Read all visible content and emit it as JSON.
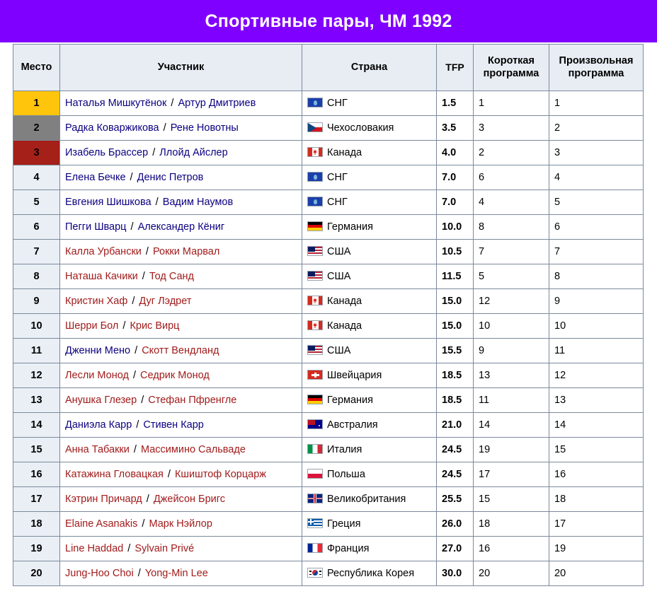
{
  "header": {
    "title": "Спортивные пары, ЧМ 1992",
    "banner_color": "#8000FF"
  },
  "table": {
    "columns": [
      {
        "key": "place",
        "label": "Место"
      },
      {
        "key": "part",
        "label": "Участник"
      },
      {
        "key": "country",
        "label": "Страна"
      },
      {
        "key": "tfp",
        "label": "TFP"
      },
      {
        "key": "sp",
        "label": "Короткая программа"
      },
      {
        "key": "fp",
        "label": "Произвольная программа"
      }
    ],
    "column_labels_wrapped": {
      "sp_line1": "Короткая",
      "sp_line2": "программа",
      "fp_line1": "Произвольная",
      "fp_line2": "программа"
    },
    "medal_colors": {
      "gold": "#FFC40C",
      "silver": "#808080",
      "bronze": "#A52019"
    },
    "link_colors": {
      "existing": "#0b0080",
      "missing": "#a11b1b"
    },
    "rows": [
      {
        "place": "1",
        "medal": "gold",
        "skater1": "Наталья Мишкутёнок",
        "skater1_color": "blue",
        "skater2": "Артур Дмитриев",
        "skater2_color": "blue",
        "flag": "fl-cis",
        "flag_name": "flag-cis",
        "country": "СНГ",
        "tfp": "1.5",
        "sp": "1",
        "fp": "1"
      },
      {
        "place": "2",
        "medal": "silver",
        "skater1": "Радка Коваржикова",
        "skater1_color": "blue",
        "skater2": "Рене Новотны",
        "skater2_color": "blue",
        "flag": "fl-cze",
        "flag_name": "flag-czechoslovakia",
        "country": "Чехословакия",
        "tfp": "3.5",
        "sp": "3",
        "fp": "2"
      },
      {
        "place": "3",
        "medal": "bronze",
        "skater1": "Изабель Брассер",
        "skater1_color": "blue",
        "skater2": "Ллойд Айслер",
        "skater2_color": "blue",
        "flag": "fl-can",
        "flag_name": "flag-canada",
        "country": "Канада",
        "tfp": "4.0",
        "sp": "2",
        "fp": "3"
      },
      {
        "place": "4",
        "medal": "",
        "skater1": "Елена Бечке",
        "skater1_color": "blue",
        "skater2": "Денис Петров",
        "skater2_color": "blue",
        "flag": "fl-cis",
        "flag_name": "flag-cis",
        "country": "СНГ",
        "tfp": "7.0",
        "sp": "6",
        "fp": "4"
      },
      {
        "place": "5",
        "medal": "",
        "skater1": "Евгения Шишкова",
        "skater1_color": "blue",
        "skater2": "Вадим Наумов",
        "skater2_color": "blue",
        "flag": "fl-cis",
        "flag_name": "flag-cis",
        "country": "СНГ",
        "tfp": "7.0",
        "sp": "4",
        "fp": "5"
      },
      {
        "place": "6",
        "medal": "",
        "skater1": "Пегги Шварц",
        "skater1_color": "blue",
        "skater2": "Александер Кёниг",
        "skater2_color": "blue",
        "flag": "fl-ger",
        "flag_name": "flag-germany",
        "country": "Германия",
        "tfp": "10.0",
        "sp": "8",
        "fp": "6"
      },
      {
        "place": "7",
        "medal": "",
        "skater1": "Калла Урбански",
        "skater1_color": "red",
        "skater2": "Рокки Марвал",
        "skater2_color": "red",
        "flag": "fl-usa",
        "flag_name": "flag-usa",
        "country": "США",
        "tfp": "10.5",
        "sp": "7",
        "fp": "7"
      },
      {
        "place": "8",
        "medal": "",
        "skater1": "Наташа Качики",
        "skater1_color": "red",
        "skater2": "Тод Санд",
        "skater2_color": "red",
        "flag": "fl-usa",
        "flag_name": "flag-usa",
        "country": "США",
        "tfp": "11.5",
        "sp": "5",
        "fp": "8"
      },
      {
        "place": "9",
        "medal": "",
        "skater1": "Кристин Хаф",
        "skater1_color": "red",
        "skater2": "Дуг Лэдрет",
        "skater2_color": "red",
        "flag": "fl-can",
        "flag_name": "flag-canada",
        "country": "Канада",
        "tfp": "15.0",
        "sp": "12",
        "fp": "9"
      },
      {
        "place": "10",
        "medal": "",
        "skater1": "Шерри Бол",
        "skater1_color": "red",
        "skater2": "Крис Вирц",
        "skater2_color": "red",
        "flag": "fl-can",
        "flag_name": "flag-canada",
        "country": "Канада",
        "tfp": "15.0",
        "sp": "10",
        "fp": "10"
      },
      {
        "place": "11",
        "medal": "",
        "skater1": "Дженни Мено",
        "skater1_color": "blue",
        "skater2": "Скотт Вендланд",
        "skater2_color": "red",
        "flag": "fl-usa",
        "flag_name": "flag-usa",
        "country": "США",
        "tfp": "15.5",
        "sp": "9",
        "fp": "11"
      },
      {
        "place": "12",
        "medal": "",
        "skater1": "Лесли Монод",
        "skater1_color": "red",
        "skater2": "Седрик Монод",
        "skater2_color": "red",
        "flag": "fl-sui",
        "flag_name": "flag-switzerland",
        "country": "Швейцария",
        "tfp": "18.5",
        "sp": "13",
        "fp": "12"
      },
      {
        "place": "13",
        "medal": "",
        "skater1": "Анушка Глезер",
        "skater1_color": "red",
        "skater2": "Стефан Пфренгле",
        "skater2_color": "red",
        "flag": "fl-ger",
        "flag_name": "flag-germany",
        "country": "Германия",
        "tfp": "18.5",
        "sp": "11",
        "fp": "13"
      },
      {
        "place": "14",
        "medal": "",
        "skater1": "Даниэла Карр",
        "skater1_color": "blue",
        "skater2": "Стивен Карр",
        "skater2_color": "blue",
        "flag": "fl-aus",
        "flag_name": "flag-australia",
        "country": "Австралия",
        "tfp": "21.0",
        "sp": "14",
        "fp": "14"
      },
      {
        "place": "15",
        "medal": "",
        "skater1": "Анна Табакки",
        "skater1_color": "red",
        "skater2": "Массимино Сальваде",
        "skater2_color": "red",
        "flag": "fl-ita",
        "flag_name": "flag-italy",
        "country": "Италия",
        "tfp": "24.5",
        "sp": "19",
        "fp": "15"
      },
      {
        "place": "16",
        "medal": "",
        "skater1": "Катажина Гловацкая",
        "skater1_color": "red",
        "skater2": "Кшиштоф Корцарж",
        "skater2_color": "red",
        "flag": "fl-pol",
        "flag_name": "flag-poland",
        "country": "Польша",
        "tfp": "24.5",
        "sp": "17",
        "fp": "16"
      },
      {
        "place": "17",
        "medal": "",
        "skater1": "Кэтрин Причард",
        "skater1_color": "red",
        "skater2": "Джейсон Бригс",
        "skater2_color": "red",
        "flag": "fl-gbr",
        "flag_name": "flag-united-kingdom",
        "country": "Великобритания",
        "tfp": "25.5",
        "sp": "15",
        "fp": "18"
      },
      {
        "place": "18",
        "medal": "",
        "skater1": "Elaine Asanakis",
        "skater1_color": "red",
        "skater2": "Марк Нэйлор",
        "skater2_color": "red",
        "flag": "fl-gre",
        "flag_name": "flag-greece",
        "country": "Греция",
        "tfp": "26.0",
        "sp": "18",
        "fp": "17"
      },
      {
        "place": "19",
        "medal": "",
        "skater1": "Line Haddad",
        "skater1_color": "red",
        "skater2": "Sylvain Privé",
        "skater2_color": "red",
        "flag": "fl-fra",
        "flag_name": "flag-france",
        "country": "Франция",
        "tfp": "27.0",
        "sp": "16",
        "fp": "19"
      },
      {
        "place": "20",
        "medal": "",
        "skater1": "Jung-Hoo Choi",
        "skater1_color": "red",
        "skater2": "Yong-Min Lee",
        "skater2_color": "red",
        "flag": "fl-kor",
        "flag_name": "flag-south-korea",
        "country": "Республика Корея",
        "tfp": "30.0",
        "sp": "20",
        "fp": "20"
      }
    ]
  }
}
